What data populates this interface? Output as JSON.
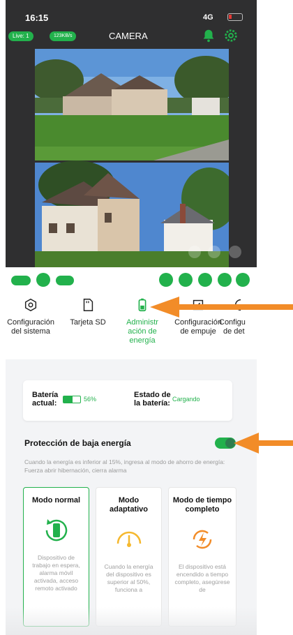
{
  "status_bar": {
    "time": "16:15",
    "network": "4G"
  },
  "header": {
    "live_badge": "Live: 1",
    "speed_badge": "123KB/s",
    "title": "CAMERA"
  },
  "tabs": [
    {
      "label": "Configuración del sistema",
      "icon": "hexagon-settings-icon"
    },
    {
      "label": "Tarjeta SD",
      "icon": "sd-card-icon"
    },
    {
      "label": "Administración de energía",
      "icon": "battery-icon",
      "active": true
    },
    {
      "label": "Configuración de empuje",
      "icon": "push-icon"
    },
    {
      "label": "Configuración de detección",
      "icon": "detection-icon"
    }
  ],
  "tab_lines": {
    "t0": [
      "Configuración",
      "del sistema"
    ],
    "t1": [
      "Tarjeta SD"
    ],
    "t2": [
      "Administr",
      "ación de",
      "energía"
    ],
    "t3": [
      "Configuración",
      "de empuje"
    ],
    "t4": [
      "Configu",
      "de det"
    ]
  },
  "battery": {
    "current_label_1": "Batería",
    "current_label_2": "actual:",
    "level_percent": "56%",
    "level_fraction": 0.56,
    "state_label_1": "Estado de",
    "state_label_2": "la batería:",
    "state_value": "Cargando"
  },
  "low_power": {
    "title": "Protección de baja energía",
    "enabled": true,
    "desc": "Cuando la energía es inferior al 15%, ingresa al modo de ahorro de energía: Fuerza abrir hibernación, cierra alarma"
  },
  "modes": [
    {
      "title": "Modo normal",
      "desc": "Dispositivo de trabajo en espera, alarma móvil activada, acceso remoto activado",
      "active": true
    },
    {
      "title": "Modo adaptativo",
      "desc": "Cuando la energía del dispositivo es superior al 50%, funciona a"
    },
    {
      "title": "Modo de tiempo completo",
      "desc": "El dispositivo está encendido a tiempo completo, asegúrese de"
    }
  ],
  "colors": {
    "accent": "#22b14c",
    "arrow": "#f28c28",
    "dark_header": "#2f2f30"
  }
}
